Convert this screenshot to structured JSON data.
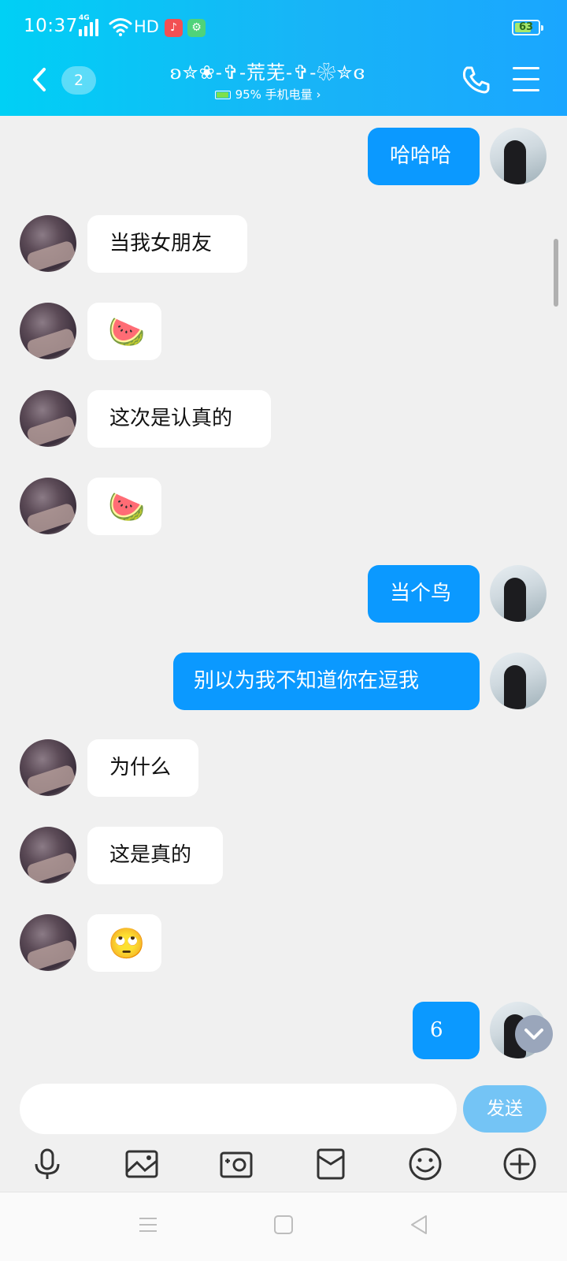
{
  "status_bar": {
    "time": "10:37",
    "network_tag": "4G",
    "hd_label": "HD",
    "battery_level": "63"
  },
  "header": {
    "unread_count": "2",
    "contact_name": "ʚ✮❀-✞-荒芜-✞-❀✮ɞ",
    "sub_status": "95% 手机电量 ›"
  },
  "messages": [
    {
      "side": "out",
      "text": "哈哈哈"
    },
    {
      "side": "in",
      "text": "当我女朋友"
    },
    {
      "side": "in",
      "text": "",
      "emoji": "🍉"
    },
    {
      "side": "in",
      "text": "这次是认真的"
    },
    {
      "side": "in",
      "text": "",
      "emoji": "🍉"
    },
    {
      "side": "out",
      "text": "当个鸟"
    },
    {
      "side": "out",
      "text": "别以为我不知道你在逗我"
    },
    {
      "side": "in",
      "text": "为什么"
    },
    {
      "side": "in",
      "text": "这是真的"
    },
    {
      "side": "in",
      "text": "",
      "emoji": "🙄"
    },
    {
      "side": "out",
      "text": "6"
    }
  ],
  "input": {
    "value": "",
    "send_label": "发送"
  },
  "toolbar_icons": [
    "microphone-icon",
    "image-icon",
    "camera-icon",
    "red-packet-icon",
    "emoji-icon",
    "plus-icon"
  ]
}
